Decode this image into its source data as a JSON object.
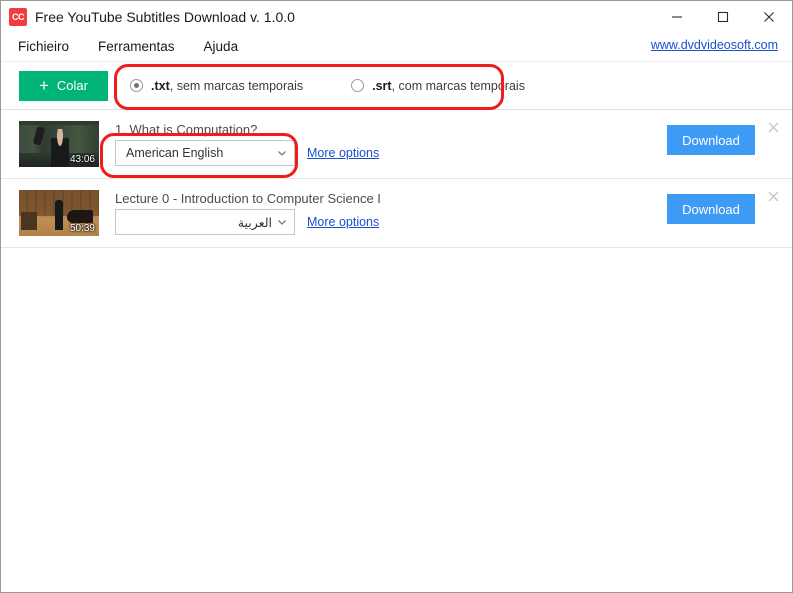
{
  "window": {
    "title": "Free YouTube Subtitles Download v. 1.0.0",
    "app_icon": "cc-icon",
    "icon_text": "CC",
    "controls": {
      "minimize": "minimize-icon",
      "maximize": "maximize-icon",
      "close": "close-icon"
    }
  },
  "menu": {
    "items": [
      {
        "label": "Fichieiro"
      },
      {
        "label": "Ferramentas"
      },
      {
        "label": "Ajuda"
      }
    ],
    "website_link": "www.dvdvideosoft.com"
  },
  "toolbar": {
    "paste_label": "Colar",
    "paste_icon": "plus-icon",
    "paste_color": "#00b377",
    "format_options": [
      {
        "bold": ".txt",
        "rest": ", sem marcas temporais",
        "selected": true
      },
      {
        "bold": ".srt",
        "rest": ", com marcas temporais",
        "selected": false
      }
    ]
  },
  "rows": [
    {
      "title": "1. What is Computation?",
      "duration": "43:06",
      "language": "American English",
      "rtl": false,
      "more_options": "More options",
      "download_label": "Download",
      "close_icon": "close-icon"
    },
    {
      "title": "Lecture 0 - Introduction to Computer Science I",
      "duration": "50:39",
      "language": "العربية",
      "rtl": true,
      "more_options": "More options",
      "download_label": "Download",
      "close_icon": "close-icon"
    }
  ],
  "annotations": {
    "format_highlight_color": "#ef1c1c",
    "language_highlight_color": "#ef1c1c"
  },
  "colors": {
    "accent_green": "#00b377",
    "accent_blue": "#3d9bf5",
    "link_blue": "#1a4fd0",
    "annotation_red": "#ef1c1c"
  }
}
